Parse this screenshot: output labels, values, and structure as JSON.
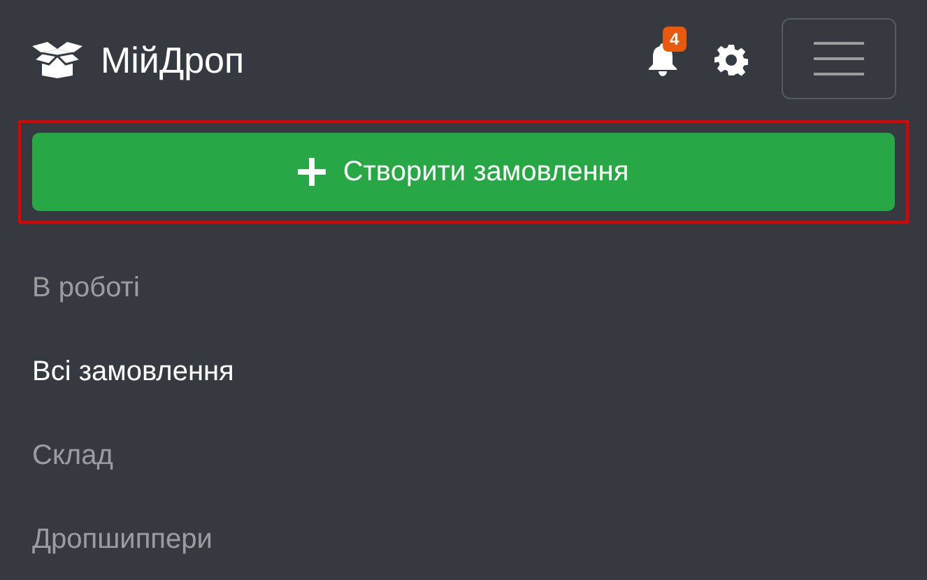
{
  "brand": {
    "name": "МійДроп"
  },
  "notifications": {
    "count": "4"
  },
  "create_button": {
    "label": "Створити замовлення"
  },
  "nav": [
    {
      "label": "В роботі",
      "selected": false
    },
    {
      "label": "Всі замовлення",
      "selected": true
    },
    {
      "label": "Склад",
      "selected": false
    },
    {
      "label": "Дропшиппери",
      "selected": false
    }
  ]
}
